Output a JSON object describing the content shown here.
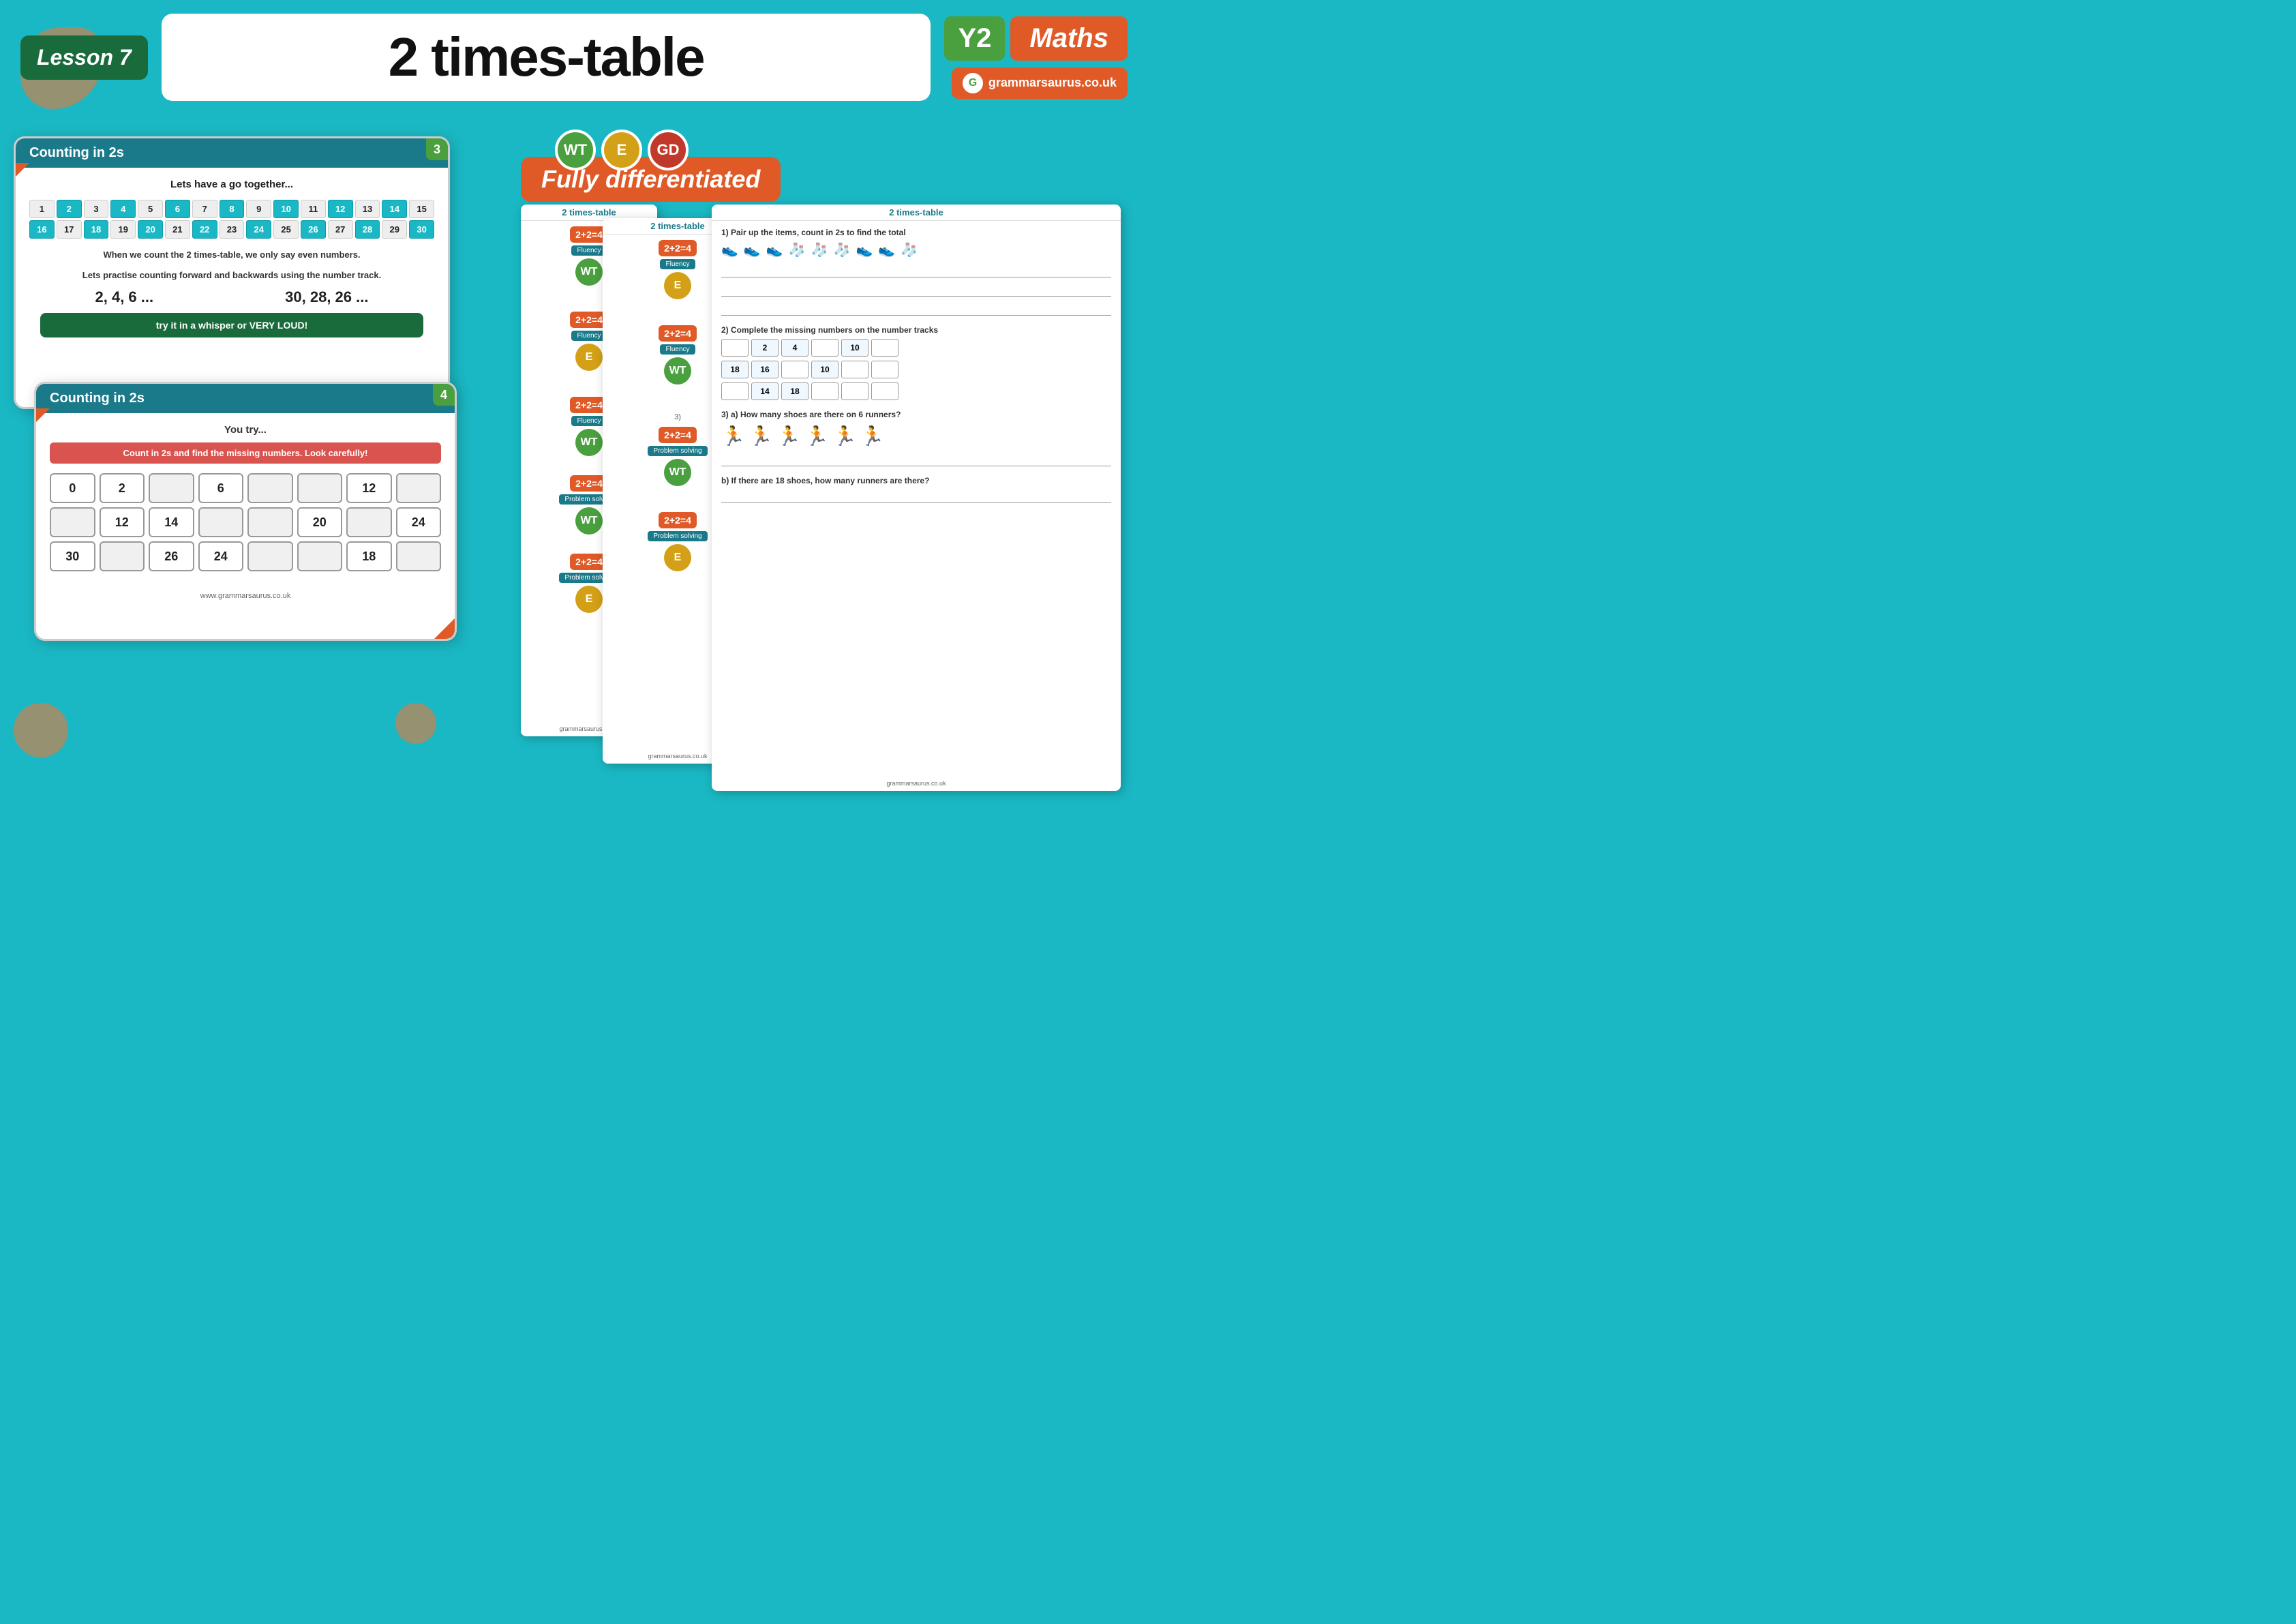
{
  "header": {
    "lesson_label": "Lesson 7",
    "main_title": "2 times-table",
    "year_badge": "Y2",
    "subject_badge": "Maths",
    "website": "grammarsaurus.co.uk"
  },
  "slide1": {
    "number": "3",
    "heading": "Counting in 2s",
    "subtitle": "Lets have a go together...",
    "number_grid": [
      [
        1,
        2,
        3,
        4,
        5,
        6,
        7,
        8,
        9,
        10,
        11,
        12,
        13,
        14,
        15
      ],
      [
        16,
        17,
        18,
        19,
        20,
        21,
        22,
        23,
        24,
        25,
        26,
        27,
        28,
        29,
        30
      ]
    ],
    "highlighted": [
      2,
      4,
      6,
      8,
      10,
      12,
      14,
      16,
      18,
      20,
      22,
      24,
      26,
      28,
      30
    ],
    "text_line1": "When we count the 2 times-table, we only say even numbers.",
    "text_line2": "Lets practise counting forward and backwards using the number track.",
    "count_forward": "2, 4, 6 ...",
    "count_backward": "30, 28, 26 ...",
    "whisper_text": "try it in a whisper or VERY LOUD!"
  },
  "slide2": {
    "number": "4",
    "heading": "Counting in 2s",
    "subtitle": "You try...",
    "instruction": "Count in 2s and find the missing numbers. Look carefully!",
    "rows": [
      [
        "0",
        "2",
        "",
        "6",
        "",
        "",
        "12",
        ""
      ],
      [
        "",
        "12",
        "14",
        "",
        "",
        "20",
        "",
        "24"
      ],
      [
        "30",
        "",
        "26",
        "24",
        "",
        "",
        "18",
        ""
      ]
    ],
    "footer": "www.grammarsaurus.co.uk"
  },
  "differentiation": {
    "badges": [
      "WT",
      "E",
      "GD"
    ],
    "banner_text": "Fully differentiated"
  },
  "worksheets": {
    "title": "2 times-table",
    "math_expr": "2+2=4",
    "fluency_label": "Fluency",
    "problem_solving_label": "Problem solving",
    "levels": [
      {
        "code": "WT",
        "class": "wt"
      },
      {
        "code": "E",
        "class": "e"
      },
      {
        "code": "GD",
        "class": "gd"
      }
    ],
    "section1_title": "1) Pair up the items, count in 2s to find the total",
    "section2_title": "2) Complete the missing numbers on the number tracks",
    "number_track1": [
      {
        "val": ""
      },
      {
        "val": "2"
      },
      {
        "val": "4"
      },
      {
        "val": ""
      },
      {
        "val": "10"
      },
      {
        "val": ""
      }
    ],
    "number_track2": [
      {
        "val": "18"
      },
      {
        "val": "16"
      },
      {
        "val": ""
      },
      {
        "val": "10"
      },
      {
        "val": ""
      },
      {
        "val": ""
      }
    ],
    "number_track3": [
      {
        "val": ""
      },
      {
        "val": "14"
      },
      {
        "val": "18"
      },
      {
        "val": ""
      },
      {
        "val": ""
      },
      {
        "val": ""
      }
    ],
    "section3_title": "3) a) How many shoes are there on 6 runners?",
    "section3b_title": "b) If there are 18 shoes, how many runners are there?"
  }
}
